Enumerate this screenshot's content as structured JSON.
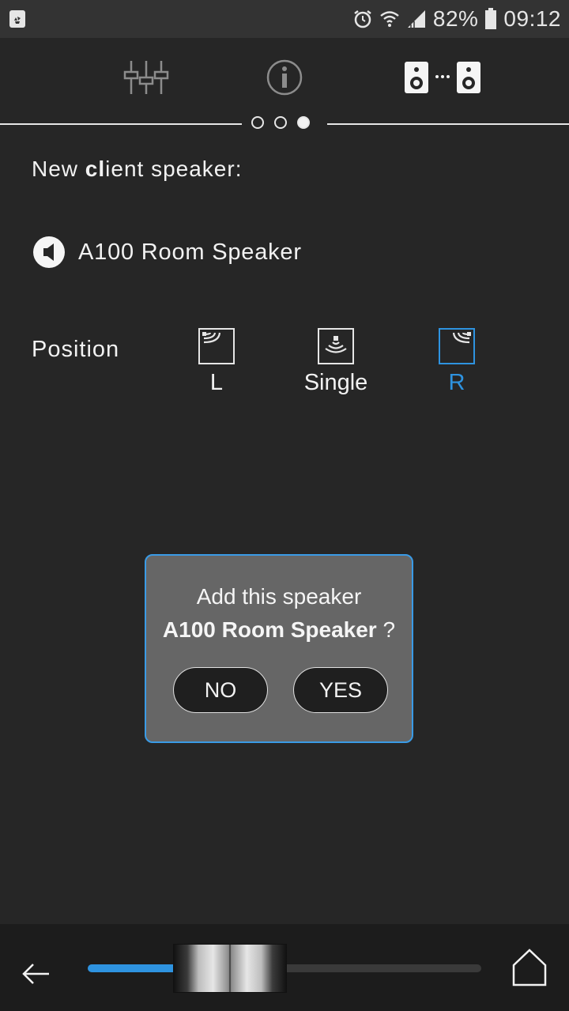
{
  "status_bar": {
    "left_icon": "recycle-icon",
    "icons": [
      "alarm-icon",
      "wifi-icon",
      "signal-icon"
    ],
    "battery_percent": "82%",
    "battery_icon": "battery-icon",
    "time": "09:12"
  },
  "nav": {
    "tabs": [
      {
        "icon": "equalizer-icon"
      },
      {
        "icon": "info-icon"
      },
      {
        "icon": "speaker-pair-icon",
        "active": true
      }
    ],
    "pager": {
      "pages": 3,
      "current": 3
    }
  },
  "heading": {
    "prefix": "New ",
    "bold": "cl",
    "suffix": "ient speaker:"
  },
  "speaker": {
    "icon": "speaker-icon",
    "name": "A100 Room Speaker"
  },
  "position": {
    "label": "Position",
    "options": [
      {
        "label": "L",
        "selected": false
      },
      {
        "label": "Single",
        "selected": false
      },
      {
        "label": "R",
        "selected": true
      }
    ]
  },
  "dialog": {
    "line1": "Add this speaker",
    "speaker_name": "A100 Room Speaker",
    "suffix": " ?",
    "no_label": "NO",
    "yes_label": "YES"
  },
  "bottom_bar": {
    "back_icon": "back-arrow-icon",
    "home_icon": "home-icon",
    "volume_level": 0.36
  },
  "colors": {
    "background": "#262626",
    "accent": "#2e93e0",
    "dialog_bg": "#666666"
  }
}
